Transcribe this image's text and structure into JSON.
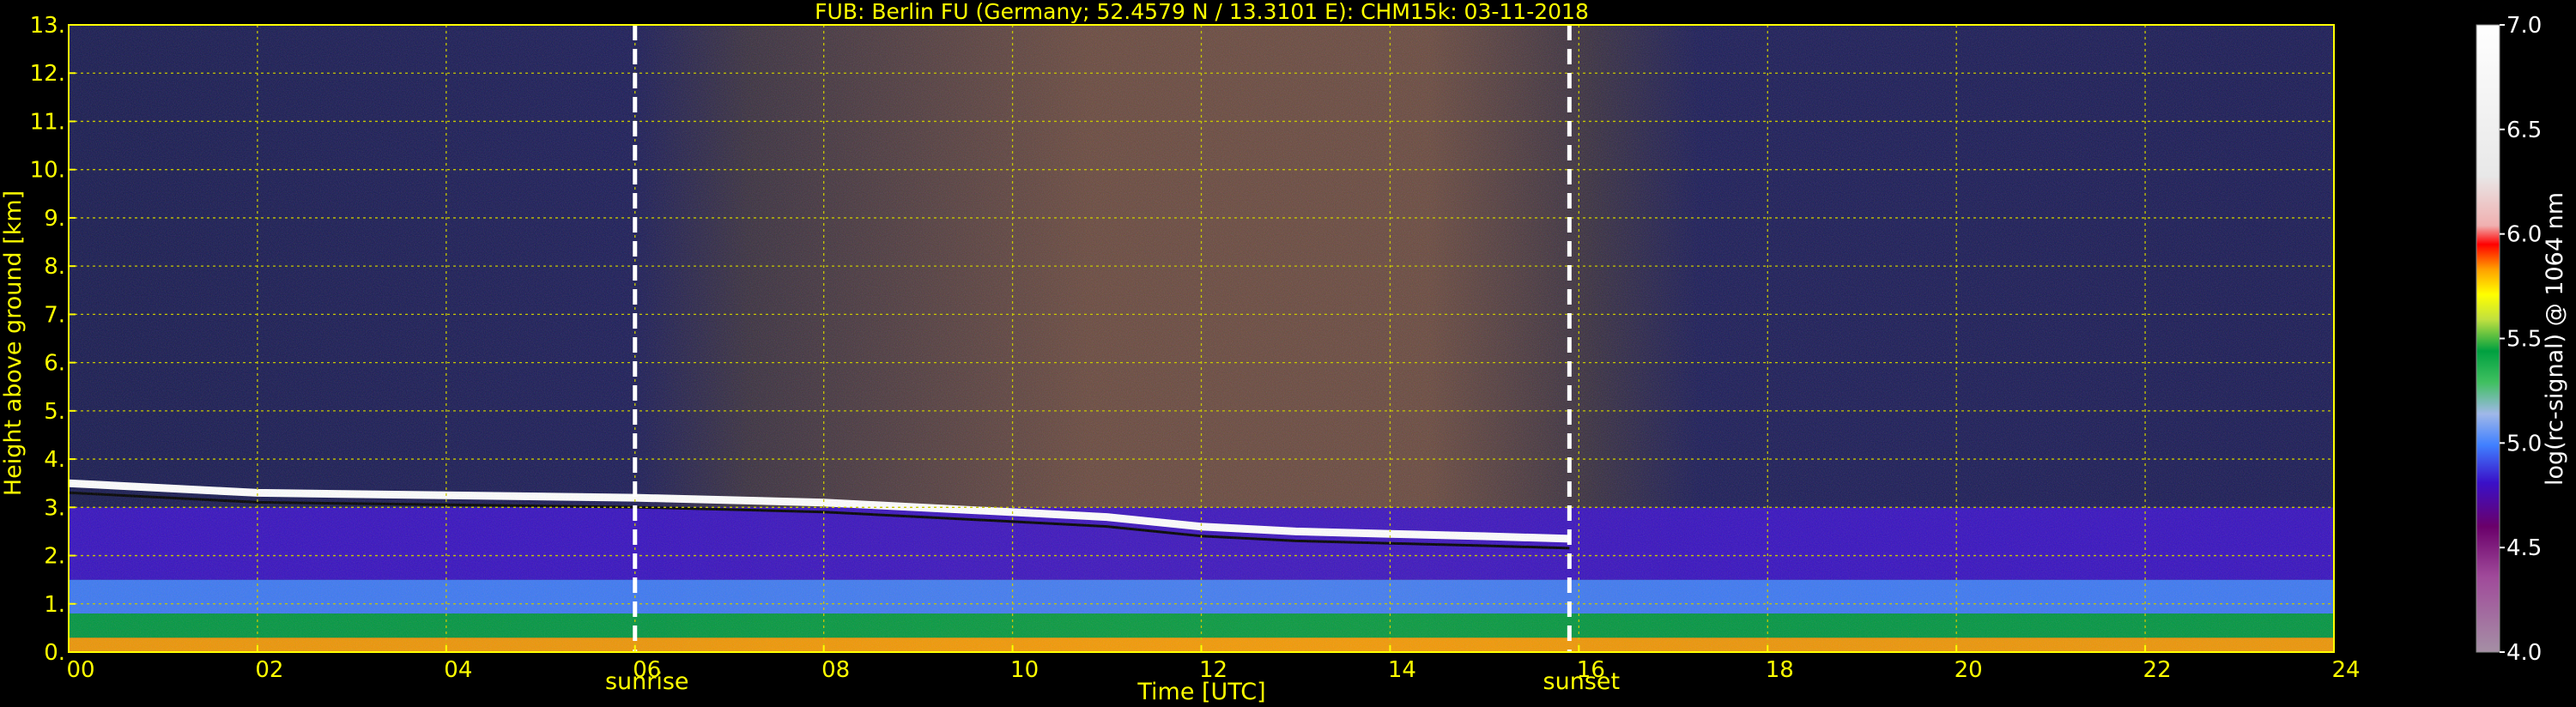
{
  "chart_data": {
    "type": "heatmap",
    "title": "FUB: Berlin FU (Germany; 52.4579 N / 13.3101 E):    CHM15k: 03-11-2018",
    "xlabel": "Time [UTC]",
    "ylabel": "Height above ground [km]",
    "colorbar_label": "log(rc-signal) @ 1064 nm",
    "xlim": [
      0,
      24
    ],
    "ylim": [
      0,
      13
    ],
    "clim": [
      4.0,
      7.0
    ],
    "x_ticks": [
      "00",
      "02",
      "04",
      "06",
      "08",
      "10",
      "12",
      "14",
      "16",
      "18",
      "20",
      "22",
      "24"
    ],
    "y_ticks": [
      "0.",
      "1.",
      "2.",
      "3.",
      "4.",
      "5.",
      "6.",
      "7.",
      "8.",
      "9.",
      "10.",
      "11.",
      "12.",
      "13."
    ],
    "colorbar_ticks": [
      "4.0",
      "4.5",
      "5.0",
      "5.5",
      "6.0",
      "6.5",
      "7.0"
    ],
    "grid": true,
    "markers": [
      {
        "label": "sunrise",
        "x": 6.0
      },
      {
        "label": "sunset",
        "x": 15.9
      }
    ],
    "layers": [
      {
        "name": "surface",
        "height_km": [
          0.0,
          0.3
        ],
        "value": 5.9
      },
      {
        "name": "lower-boundary-layer",
        "height_km": [
          0.3,
          0.8
        ],
        "value": 5.5
      },
      {
        "name": "boundary-layer",
        "height_km": [
          0.8,
          1.5
        ],
        "value": 5.1
      },
      {
        "name": "residual-layer",
        "height_km": [
          1.5,
          3.0
        ],
        "value": 4.8
      },
      {
        "name": "cloud-top",
        "height_km": [
          3.0,
          3.5
        ],
        "value": 7.0
      },
      {
        "name": "free-troposphere",
        "height_km": [
          3.5,
          13.0
        ],
        "value": 4.6
      }
    ],
    "cloud_base_km": {
      "x": [
        0,
        2,
        4,
        6,
        8,
        10,
        11,
        12,
        13,
        14,
        15,
        15.9
      ],
      "y": [
        3.5,
        3.3,
        3.25,
        3.2,
        3.1,
        2.9,
        2.8,
        2.6,
        2.5,
        2.45,
        2.4,
        2.35
      ]
    }
  }
}
